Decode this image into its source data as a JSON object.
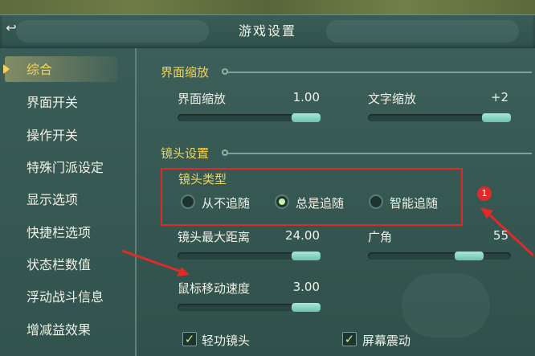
{
  "title_bar": {
    "title": "游戏设置",
    "back_icon": "back-arrow-icon"
  },
  "sidebar": {
    "items": [
      {
        "label": "综合",
        "active": true
      },
      {
        "label": "界面开关"
      },
      {
        "label": "操作开关"
      },
      {
        "label": "特殊门派设定"
      },
      {
        "label": "显示选项"
      },
      {
        "label": "快捷栏选项"
      },
      {
        "label": "状态栏数值"
      },
      {
        "label": "浮动战斗信息"
      },
      {
        "label": "增减益效果"
      }
    ]
  },
  "ui_scale": {
    "section_title": "界面缩放",
    "interface_scale": {
      "label": "界面缩放",
      "value": "1.00",
      "level": 0.85
    },
    "text_scale": {
      "label": "文字缩放",
      "value": "+2",
      "level": 0.9
    }
  },
  "camera": {
    "section_title": "镜头设置",
    "type": {
      "label": "镜头类型",
      "options": [
        "从不追随",
        "总是追随",
        "智能追随"
      ],
      "selected": "总是追随"
    },
    "max_distance": {
      "label": "镜头最大距离",
      "value": "24.00",
      "level": 0.85
    },
    "wide_angle": {
      "label": "广角",
      "value": "55",
      "level": 0.65
    },
    "mouse_speed": {
      "label": "鼠标移动速度",
      "value": "3.00",
      "level": 0.85
    },
    "checkboxes": [
      {
        "label": "轻功镜头",
        "checked": true
      },
      {
        "label": "屏幕震动",
        "checked": true
      }
    ]
  },
  "annotation": {
    "badge": "1",
    "color": "#e02a2a"
  },
  "colors": {
    "accent": "#f0d45a",
    "knob": "#6cc3ae"
  }
}
